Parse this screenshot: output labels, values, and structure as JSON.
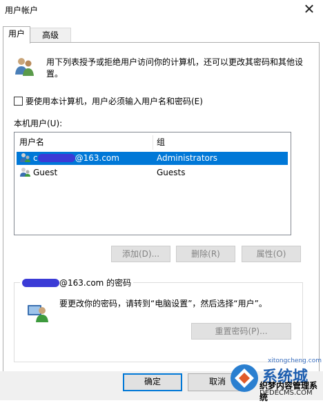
{
  "window": {
    "title": "用户帐户",
    "close_glyph": "✕"
  },
  "tabs": [
    {
      "label": "用户",
      "active": true
    },
    {
      "label": "高级",
      "active": false
    }
  ],
  "intro_text": "用下列表授予或拒绝用户访问你的计算机，还可以更改其密码和其他设置。",
  "require_login": {
    "label": "要使用本计算机，用户必须输入用户名和密码(E)",
    "checked": false
  },
  "users_list": {
    "label": "本机用户(U):",
    "columns": [
      "用户名",
      "组"
    ],
    "rows": [
      {
        "name_prefix": "c",
        "name_suffix": "@163.com",
        "group": "Administrators",
        "selected": true
      },
      {
        "name_prefix": "",
        "name_suffix": "Guest",
        "group": "Guests",
        "selected": false
      }
    ]
  },
  "actions": {
    "add": "添加(D)...",
    "remove": "删除(R)",
    "properties": "属性(O)"
  },
  "password_group": {
    "title_suffix": "@163.com 的密码",
    "text": "要更改你的密码，请转到“电脑设置”，然后选择“用户”。",
    "reset_button": "重置密码(P)..."
  },
  "dialog_buttons": {
    "ok": "确定",
    "cancel": "取消"
  },
  "watermark": {
    "line1": "系统城",
    "line2": "织梦内容管理系统",
    "line3": "DEDECMS.COM",
    "line4": "xitongcheng.com"
  },
  "colors": {
    "accent": "#0078d7",
    "selection": "#0078d7",
    "disabled_text": "#838383",
    "redaction": "#3b3bd6"
  }
}
